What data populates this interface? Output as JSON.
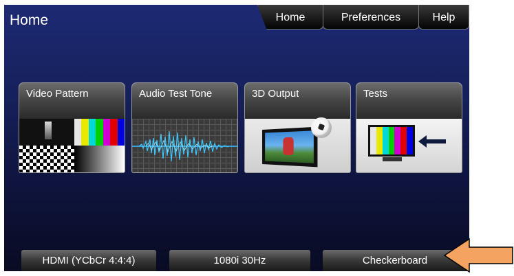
{
  "header": {
    "title": "Home"
  },
  "nav": {
    "tabs": [
      "Home",
      "Preferences",
      "Help"
    ]
  },
  "cards": [
    {
      "label": "Video Pattern"
    },
    {
      "label": "Audio Test Tone"
    },
    {
      "label": "3D Output"
    },
    {
      "label": "Tests"
    }
  ],
  "status": {
    "interface": "HDMI (YCbCr 4:4:4)",
    "format": "1080i 30Hz",
    "pattern": "Checkerboard"
  },
  "colors": {
    "callout": "#f4a460",
    "colorbars": [
      "#e6e6e6",
      "#e8e800",
      "#00d8d8",
      "#00d000",
      "#d000d0",
      "#e00000",
      "#0000e0"
    ]
  },
  "icons": [
    "orange-callout-arrow-icon"
  ]
}
